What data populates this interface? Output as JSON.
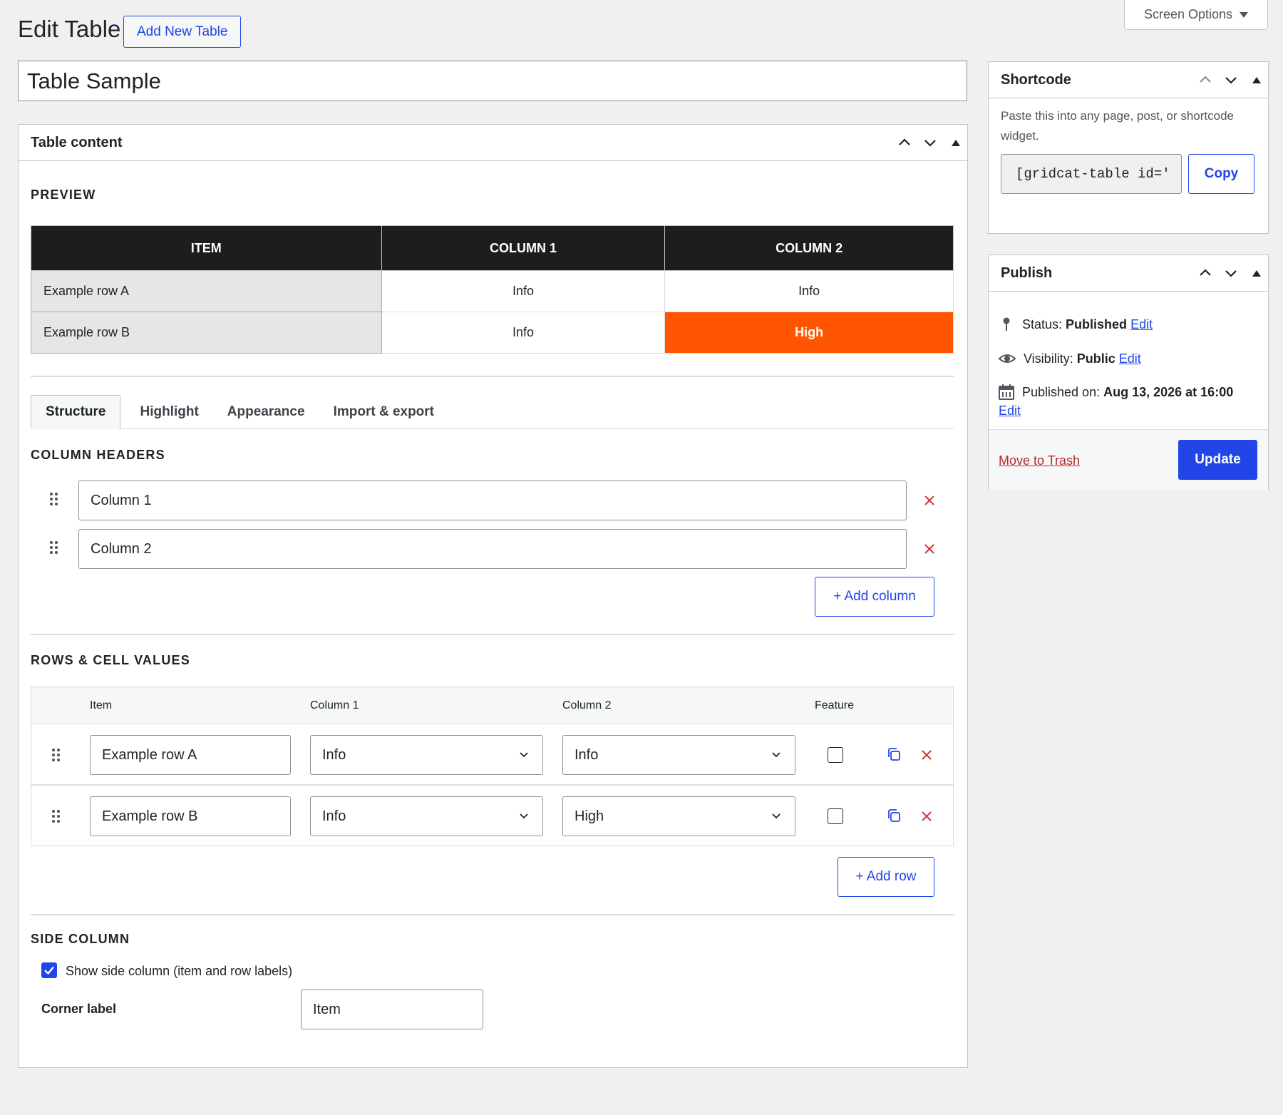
{
  "header": {
    "title": "Edit Table",
    "add_new_label": "Add New Table",
    "screen_options_label": "Screen Options"
  },
  "title_field": {
    "value": "Table Sample"
  },
  "table_content": {
    "heading": "Table content",
    "preview_label": "PREVIEW",
    "preview": {
      "headers": [
        "ITEM",
        "COLUMN 1",
        "COLUMN 2"
      ],
      "rows": [
        [
          "Example row A",
          "Info",
          "Info"
        ],
        [
          "Example row B",
          "Info",
          "High"
        ]
      ],
      "highlight_color": "#ff5500",
      "header_bg": "#1d1d1f"
    },
    "tabs": [
      "Structure",
      "Highlight",
      "Appearance",
      "Import & export"
    ],
    "active_tab": "Structure",
    "column_headers_label": "COLUMN HEADERS",
    "column_headers": [
      "Column 1",
      "Column 2"
    ],
    "add_column_label": "+ Add column",
    "rows_label": "ROWS & CELL VALUES",
    "rows_table": {
      "headers": [
        "Item",
        "Column 1",
        "Column 2",
        "Feature"
      ],
      "rows": [
        {
          "item": "Example row A",
          "col1": "Info",
          "col2": "Info",
          "feature": false
        },
        {
          "item": "Example row B",
          "col1": "Info",
          "col2": "High",
          "feature": false
        }
      ]
    },
    "add_row_label": "+ Add row",
    "side_column_label": "SIDE COLUMN",
    "show_side_column_label": "Show side column (item and row labels)",
    "show_side_column": true,
    "corner_label_label": "Corner label",
    "corner_label_value": "Item"
  },
  "shortcode": {
    "heading": "Shortcode",
    "description": "Paste this into any page, post, or shortcode widget.",
    "code": "[gridcat-table id='",
    "copy_label": "Copy"
  },
  "publish": {
    "heading": "Publish",
    "status_label": "Status:",
    "status_value": "Published",
    "visibility_label": "Visibility:",
    "visibility_value": "Public",
    "published_label": "Published on:",
    "published_value": "Aug 13, 2026 at 16:00",
    "edit_label": "Edit",
    "trash_label": "Move to Trash",
    "update_label": "Update"
  },
  "colors": {
    "accent": "#2145e6",
    "delete": "#d63638",
    "trash": "#b32d2e"
  }
}
